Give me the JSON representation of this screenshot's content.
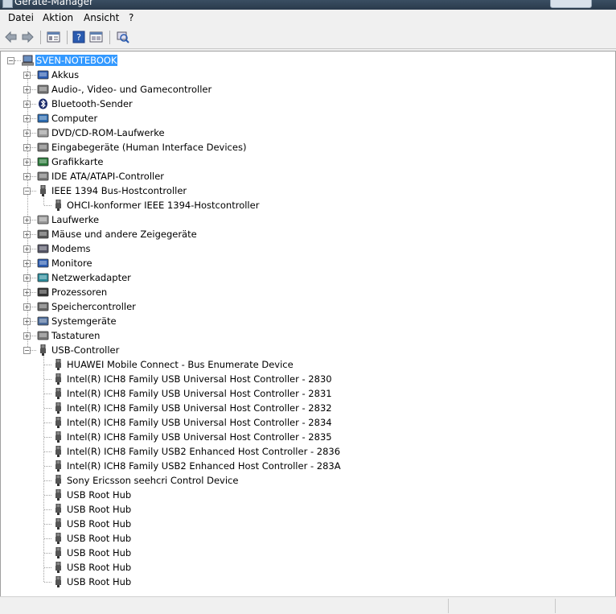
{
  "window": {
    "title": "Geräte-Manager"
  },
  "menu": {
    "items": [
      "Datei",
      "Aktion",
      "Ansicht",
      "?"
    ]
  },
  "toolbar": {
    "buttons": [
      "back-arrow-icon",
      "forward-arrow-icon",
      "properties-icon",
      "help-icon",
      "show-hidden-icon",
      "scan-hardware-icon"
    ]
  },
  "tree": {
    "root": "SVEN-NOTEBOOK",
    "categories": [
      "Akkus",
      "Audio-, Video- und Gamecontroller",
      "Bluetooth-Sender",
      "Computer",
      "DVD/CD-ROM-Laufwerke",
      "Eingabegeräte (Human Interface Devices)",
      "Grafikkarte",
      "IDE ATA/ATAPI-Controller",
      "IEEE 1394 Bus-Hostcontroller",
      "Laufwerke",
      "Mäuse und andere Zeigegeräte",
      "Modems",
      "Monitore",
      "Netzwerkadapter",
      "Prozessoren",
      "Speichercontroller",
      "Systemgeräte",
      "Tastaturen",
      "USB-Controller"
    ],
    "ieee_children": [
      "OHCI-konformer IEEE 1394-Hostcontroller"
    ],
    "usb_children": [
      "HUAWEI Mobile Connect - Bus Enumerate Device",
      "Intel(R) ICH8 Family USB Universal Host Controller - 2830",
      "Intel(R) ICH8 Family USB Universal Host Controller - 2831",
      "Intel(R) ICH8 Family USB Universal Host Controller - 2832",
      "Intel(R) ICH8 Family USB Universal Host Controller - 2834",
      "Intel(R) ICH8 Family USB Universal Host Controller - 2835",
      "Intel(R) ICH8 Family USB2 Enhanced Host Controller - 2836",
      "Intel(R) ICH8 Family USB2 Enhanced Host Controller - 283A",
      "Sony Ericsson seehcri Control Device",
      "USB Root Hub",
      "USB Root Hub",
      "USB Root Hub",
      "USB Root Hub",
      "USB Root Hub",
      "USB Root Hub",
      "USB Root Hub"
    ],
    "expanded": [
      "IEEE 1394 Bus-Hostcontroller",
      "USB-Controller"
    ]
  },
  "colors": {
    "selection": "#3399ff",
    "tree_background": "#ffffff"
  }
}
